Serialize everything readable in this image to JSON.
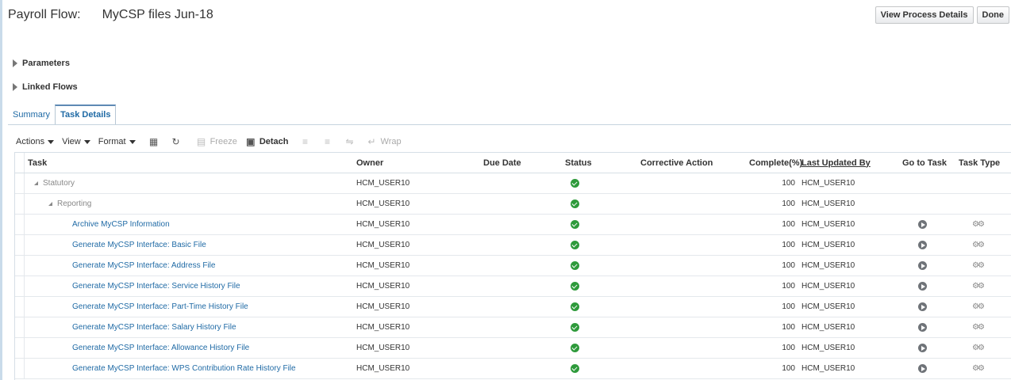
{
  "header": {
    "label": "Payroll Flow:",
    "title": "MyCSP files Jun-18",
    "buttons": {
      "view_process_details": "View Process Details",
      "done": "Done"
    }
  },
  "sections": {
    "parameters": "Parameters",
    "linked_flows": "Linked Flows"
  },
  "tabs": [
    {
      "label": "Summary",
      "active": false
    },
    {
      "label": "Task Details",
      "active": true
    }
  ],
  "toolbar": {
    "actions": "Actions",
    "view": "View",
    "format": "Format",
    "freeze": "Freeze",
    "detach": "Detach",
    "wrap": "Wrap"
  },
  "table": {
    "columns": {
      "task": "Task",
      "owner": "Owner",
      "due_date": "Due Date",
      "status": "Status",
      "corrective_action": "Corrective Action",
      "complete": "Complete(%)",
      "last_updated_by": "Last Updated By",
      "go_to_task": "Go to Task",
      "task_type": "Task Type"
    },
    "rows": [
      {
        "task": "Statutory",
        "owner": "HCM_USER10",
        "complete": "100",
        "updated_by": "HCM_USER10"
      },
      {
        "task": "Reporting",
        "owner": "HCM_USER10",
        "complete": "100",
        "updated_by": "HCM_USER10"
      },
      {
        "task": "Archive MyCSP Information",
        "owner": "HCM_USER10",
        "complete": "100",
        "updated_by": "HCM_USER10"
      },
      {
        "task": "Generate MyCSP Interface: Basic File",
        "owner": "HCM_USER10",
        "complete": "100",
        "updated_by": "HCM_USER10"
      },
      {
        "task": "Generate MyCSP Interface: Address File",
        "owner": "HCM_USER10",
        "complete": "100",
        "updated_by": "HCM_USER10"
      },
      {
        "task": "Generate MyCSP Interface: Service History File",
        "owner": "HCM_USER10",
        "complete": "100",
        "updated_by": "HCM_USER10"
      },
      {
        "task": "Generate MyCSP Interface: Part-Time History File",
        "owner": "HCM_USER10",
        "complete": "100",
        "updated_by": "HCM_USER10"
      },
      {
        "task": "Generate MyCSP Interface: Salary History File",
        "owner": "HCM_USER10",
        "complete": "100",
        "updated_by": "HCM_USER10"
      },
      {
        "task": "Generate MyCSP Interface: Allowance History File",
        "owner": "HCM_USER10",
        "complete": "100",
        "updated_by": "HCM_USER10"
      },
      {
        "task": "Generate MyCSP Interface: WPS Contribution Rate History File",
        "owner": "HCM_USER10",
        "complete": "100",
        "updated_by": "HCM_USER10"
      }
    ]
  },
  "colors": {
    "link": "#1f6aa5",
    "status_ok": "#2e9a3b"
  },
  "icons": {
    "status": "check-circle-icon",
    "go_to_task": "arrow-circle-icon",
    "task_type": "gears-icon"
  }
}
